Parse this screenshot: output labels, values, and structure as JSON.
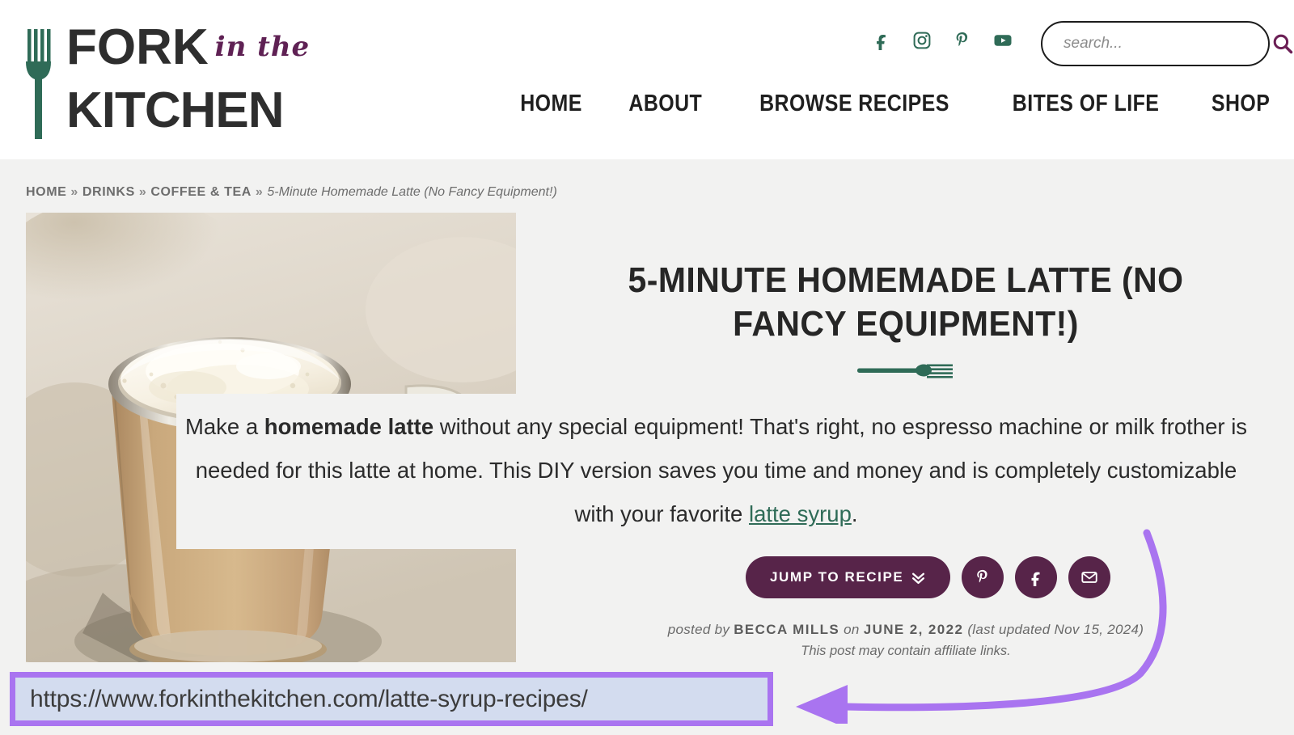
{
  "site": {
    "logo_line1": "FORK",
    "logo_script": "in the",
    "logo_line2": "KITCHEN"
  },
  "header": {
    "social": [
      {
        "name": "facebook-icon",
        "label": "Facebook"
      },
      {
        "name": "instagram-icon",
        "label": "Instagram"
      },
      {
        "name": "pinterest-icon",
        "label": "Pinterest"
      },
      {
        "name": "youtube-icon",
        "label": "YouTube"
      }
    ],
    "search": {
      "placeholder": "search...",
      "value": "",
      "icon": "search-icon"
    },
    "nav": [
      {
        "label": "HOME"
      },
      {
        "label": "ABOUT"
      },
      {
        "label": "BROWSE RECIPES"
      },
      {
        "label": "BITES OF LIFE"
      },
      {
        "label": "SHOP"
      }
    ]
  },
  "breadcrumb": {
    "items": [
      {
        "label": "HOME"
      },
      {
        "label": "DRINKS"
      },
      {
        "label": "COFFEE & TEA"
      }
    ],
    "separator": "»",
    "current": "5-Minute Homemade Latte (No Fancy Equipment!)"
  },
  "post": {
    "title": "5-MINUTE HOMEMADE LATTE (NO FANCY EQUIPMENT!)",
    "divider_icon": "fork-divider-icon",
    "hero_image_alt": "Glass mug of homemade latte with thick milk foam",
    "description": {
      "part1": "Make a ",
      "bold1": "homemade latte",
      "part2": " without any special equipment! That's right, no espresso machine or milk frother is needed for this latte at home. This DIY version saves you time and money and is completely customizable with your favorite ",
      "link_text": "latte syrup",
      "part3": "."
    },
    "actions": {
      "jump_label": "JUMP TO RECIPE",
      "jump_icon": "double-chevron-down-icon",
      "share": [
        {
          "name": "pinterest-share-icon",
          "label": "Save to Pinterest"
        },
        {
          "name": "facebook-share-icon",
          "label": "Share on Facebook"
        },
        {
          "name": "email-share-icon",
          "label": "Share by Email"
        }
      ]
    },
    "byline": {
      "posted_by_label": "posted by",
      "author": "BECCA MILLS",
      "on_label": "on",
      "date": "JUNE 2, 2022",
      "updated": "(last updated Nov 15, 2024)"
    },
    "affiliate_note": "This post may contain affiliate links."
  },
  "annotation": {
    "url": "https://www.forkinthekitchen.com/latte-syrup-recipes/",
    "arrow_name": "callout-arrow",
    "highlight_color": "#a974f0"
  },
  "colors": {
    "brand_green": "#2f6b57",
    "brand_purple": "#572449",
    "page_bg": "#f2f2f1",
    "text_dark": "#262626",
    "annotation_purple": "#a974f0",
    "url_box_fill": "#d3dcef"
  }
}
